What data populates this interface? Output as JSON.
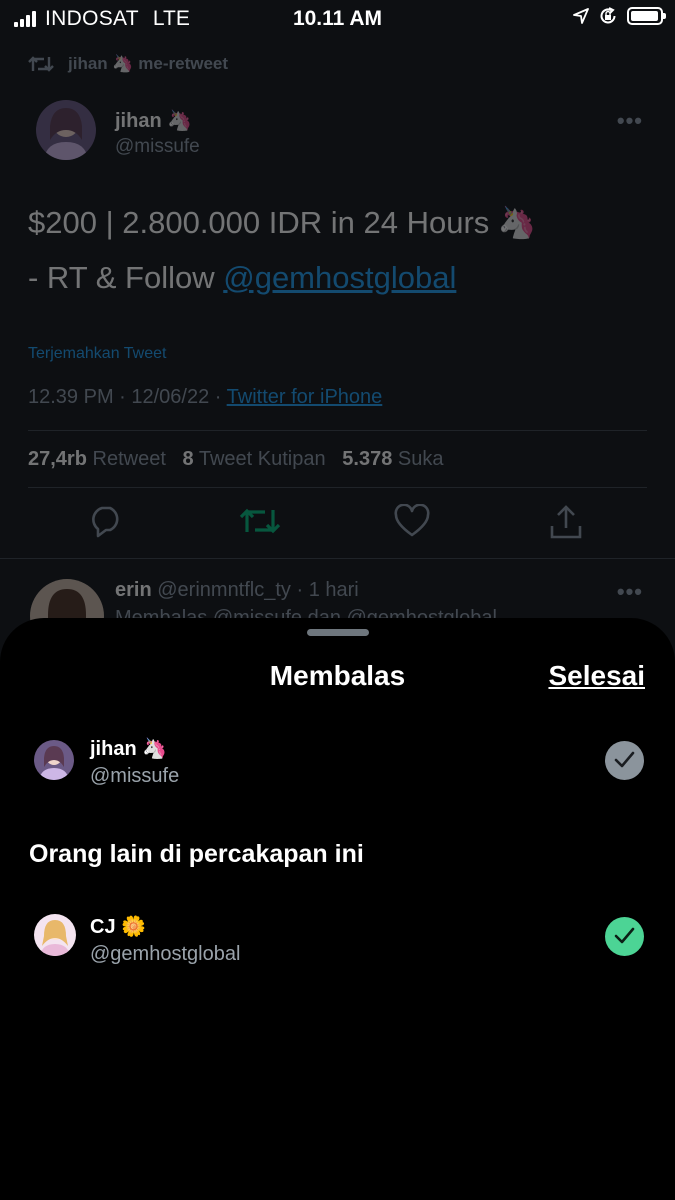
{
  "status_bar": {
    "carrier": "INDOSAT",
    "network": "LTE",
    "time": "10.11 AM",
    "icons": [
      "location-icon",
      "orientation-lock-icon",
      "battery-icon"
    ],
    "battery_level": 0.95
  },
  "tweet": {
    "retweeted_by": "jihan 🦄 me-retweet",
    "author_name": "jihan 🦄",
    "author_handle": "@missufe",
    "text_line1": "$200 | 2.800.000 IDR in 24 Hours 🦄",
    "text_line2_prefix": "- RT & Follow ",
    "text_line2_mention": "@gemhostglobal",
    "translate_label": "Terjemahkan Tweet",
    "time_date": "12.39 PM · 12/06/22 · ",
    "source": "Twitter for iPhone",
    "stats": {
      "retweets_count": "27,4rb",
      "retweets_label": "Retweet",
      "quotes_count": "8",
      "quotes_label": "Tweet Kutipan",
      "likes_count": "5.378",
      "likes_label": "Suka"
    },
    "actions": [
      "reply-icon",
      "retweet-icon",
      "like-icon",
      "share-icon"
    ],
    "more": "•••"
  },
  "reply_preview": {
    "name": "erin",
    "handle_time": "@erinmntflc_ty · 1 hari",
    "replying_to": "Membalas @missufe dan @gemhostglobal",
    "more": "•••"
  },
  "sheet": {
    "title": "Membalas",
    "done_label": "Selesai",
    "primary_user": {
      "name": "jihan 🦄",
      "handle": "@missufe",
      "selected": true
    },
    "others_heading": "Orang lain di percakapan ini",
    "others": [
      {
        "name": "CJ 🌼",
        "handle": "@gemhostglobal",
        "selected": true
      }
    ]
  },
  "colors": {
    "accent": "#1d9bf0",
    "check_green": "#4cd495",
    "check_gray": "#8b949c",
    "retweet_green": "#00ba7c"
  }
}
